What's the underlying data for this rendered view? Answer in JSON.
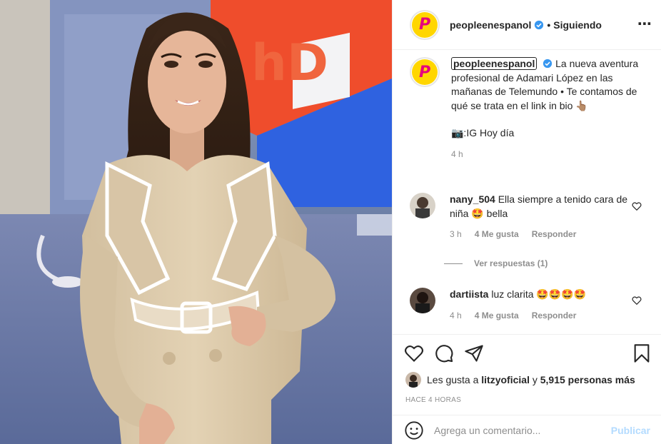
{
  "post": {
    "username": "peopleenespanol",
    "follow_status": "Siguiendo",
    "avatar_letter": "P",
    "caption": {
      "username": "peopleenespanol",
      "text_line1": "La nueva aventura profesional de Adamari López en las mañanas de Telemundo • Te contamos de qué se trata en el link in bio",
      "text_line2": "📷:IG Hoy día",
      "time": "4 h",
      "pointer_emoji": "👆🏽"
    },
    "comments": [
      {
        "username": "nany_504",
        "text": "Ella siempre a tenido cara de niña 🤩 bella",
        "time": "3 h",
        "likes": "4 Me gusta",
        "reply": "Responder",
        "view_replies": "Ver respuestas (1)"
      },
      {
        "username": "dartiista",
        "text": "luz clarita 🤩🤩🤩🤩",
        "time": "4 h",
        "likes": "4 Me gusta",
        "reply": "Responder"
      }
    ],
    "likes_prefix": "Les gusta a",
    "likes_user": "litzyoficial",
    "likes_conj": "y",
    "likes_count": "5,915 personas más",
    "posted_ago": "HACE 4 HORAS",
    "comment_placeholder": "Agrega un comentario...",
    "publish_label": "Publicar"
  },
  "photo": {
    "screen_text": "hD"
  },
  "icons": {
    "more": "more-options-icon",
    "like": "heart-icon",
    "comment": "comment-icon",
    "share": "share-icon",
    "save": "bookmark-icon",
    "emoji": "emoji-icon"
  },
  "colors": {
    "verified": "#3897f0",
    "brand_yellow": "#ffd600",
    "brand_pink": "#e6007e",
    "publish_disabled": "#b3dbff"
  }
}
